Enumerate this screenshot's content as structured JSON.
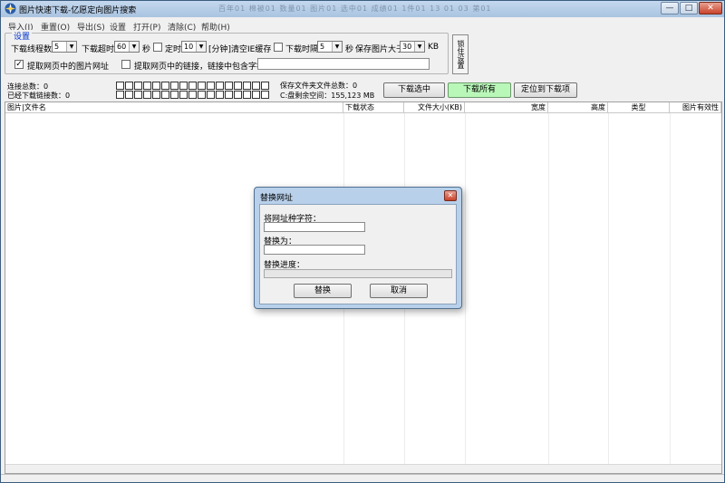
{
  "window": {
    "title": "图片快速下载-亿愿定向图片搜索",
    "title_bar_extra": "百年01  棉被01  数量01  图片01  选中01  成绩01  1件01  13  01  03  第01",
    "controls": {
      "minimize": "—",
      "maximize": "□",
      "close": "✕"
    }
  },
  "menu": [
    "导入(I)",
    "重置(O)",
    "导出(S)",
    "设置",
    "打开(P)",
    "清除(C)",
    "帮助(H)"
  ],
  "settings": {
    "legend": "设置",
    "threads_label": "下载线程数",
    "threads_value": "5",
    "timeout_label": "下载超时",
    "timeout_value": "60",
    "seconds": "秒",
    "timer_label": "定时",
    "timer_value": "10",
    "timer_suffix": "[分钟]清空IE缓存",
    "interval_label": "下载时隔",
    "interval_value": "5",
    "interval_unit": "秒",
    "savesize_label": "保存图片大于",
    "savesize_value": "30",
    "savesize_unit": "KB",
    "extract_img_label": "提取网页中的图片网址",
    "extract_img_checked": "✓",
    "extract_link_label": "提取网页中的链接，链接中包含字符：",
    "lock_button": "锁住设置"
  },
  "stats": {
    "link_total": "连接总数：0",
    "downloaded_links": "已经下载链接数：0",
    "saved_total": "保存文件夹文件总数：0",
    "disk_free": "C:盘剩余空间：155,123 MB"
  },
  "actions": {
    "download_selected": "下载选中",
    "download_all": "下载所有",
    "locate_download": "定位到下载项"
  },
  "table": {
    "columns": [
      "图片|文件名",
      "下载状态",
      "文件大小(KB)",
      "宽度",
      "高度",
      "类型",
      "图片有效性"
    ]
  },
  "dialog": {
    "title": "替换网址",
    "close": "✕",
    "source_label": "将网址种字符：",
    "replace_label": "替换为：",
    "progress_label": "替换进度：",
    "ok_button": "替换",
    "cancel_button": "取消"
  }
}
